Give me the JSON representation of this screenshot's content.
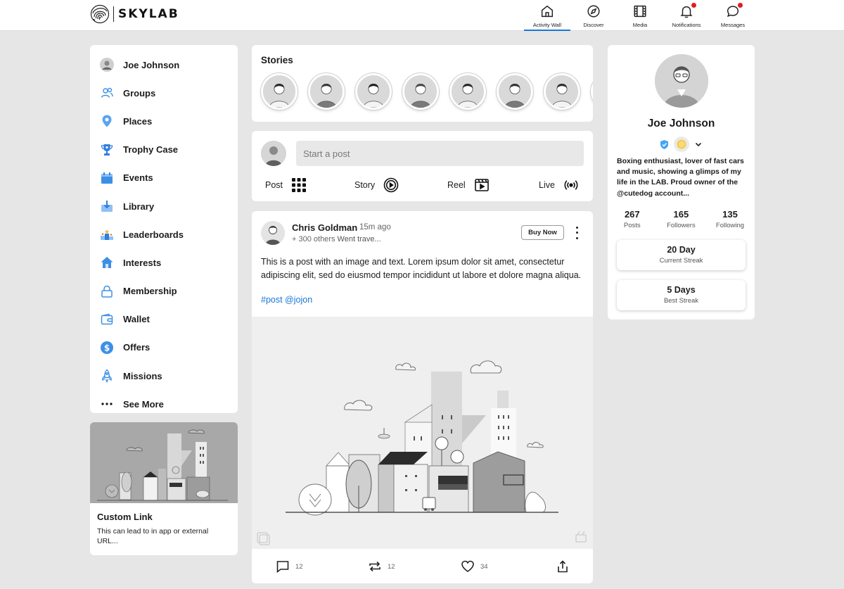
{
  "brand": {
    "name": "SKYLAB"
  },
  "nav": [
    {
      "label": "Activity Wall",
      "icon": "home-icon",
      "active": true,
      "notification": false
    },
    {
      "label": "Discover",
      "icon": "compass-icon",
      "active": false,
      "notification": false
    },
    {
      "label": "Media",
      "icon": "film-icon",
      "active": false,
      "notification": false
    },
    {
      "label": "Notifications",
      "icon": "bell-icon",
      "active": false,
      "notification": true
    },
    {
      "label": "Messages",
      "icon": "chat-icon",
      "active": false,
      "notification": true
    }
  ],
  "sidebar": {
    "items": [
      {
        "label": "Joe Johnson",
        "icon": "avatar"
      },
      {
        "label": "Groups",
        "icon": "users-icon"
      },
      {
        "label": "Places",
        "icon": "map-pin-icon"
      },
      {
        "label": "Trophy Case",
        "icon": "trophy-icon"
      },
      {
        "label": "Events",
        "icon": "calendar-icon"
      },
      {
        "label": "Library",
        "icon": "download-icon"
      },
      {
        "label": "Leaderboards",
        "icon": "podium-icon"
      },
      {
        "label": "Interests",
        "icon": "house-icon"
      },
      {
        "label": "Membership",
        "icon": "lock-icon"
      },
      {
        "label": "Wallet",
        "icon": "wallet-icon"
      },
      {
        "label": "Offers",
        "icon": "dollar-icon"
      },
      {
        "label": "Missions",
        "icon": "rocket-icon"
      },
      {
        "label": "See More",
        "icon": "ellipsis-icon"
      }
    ]
  },
  "custom_link": {
    "title": "Custom Link",
    "text": "This can lead to in app or external URL..."
  },
  "stories": {
    "title": "Stories",
    "count": 7
  },
  "composer": {
    "placeholder": "Start a post",
    "actions": [
      {
        "label": "Post",
        "icon": "grid-icon"
      },
      {
        "label": "Story",
        "icon": "play-circle-icon"
      },
      {
        "label": "Reel",
        "icon": "reel-icon"
      },
      {
        "label": "Live",
        "icon": "broadcast-icon"
      }
    ]
  },
  "post": {
    "author": "Chris Goldman",
    "time": "15m ago",
    "others": "+ 300 others",
    "activity": "Went trave...",
    "buy_label": "Buy Now",
    "text": "This is a post with an image and text.  Lorem ipsum dolor sit amet, consectetur adipiscing elit, sed do eiusmod tempor incididunt ut labore et dolore magna aliqua.",
    "tags": "#post @jojon",
    "comments": "12",
    "reposts": "12",
    "likes": "34"
  },
  "profile": {
    "name": "Joe Johnson",
    "bio": "Boxing enthusiast, lover of fast cars and music, showing a glimps of my life in the LAB. Proud owner of the @cutedog account...",
    "stats": [
      {
        "value": "267",
        "label": "Posts"
      },
      {
        "value": "165",
        "label": "Followers"
      },
      {
        "value": "135",
        "label": "Following"
      }
    ],
    "streaks": [
      {
        "value": "20 Day",
        "label": "Current Streak"
      },
      {
        "value": "5 Days",
        "label": "Best Streak"
      }
    ]
  },
  "colors": {
    "accent": "#1877d6",
    "icon_blue": "#3d8fe6",
    "badge_red": "#e41b1b",
    "background": "#e6e6e6"
  }
}
